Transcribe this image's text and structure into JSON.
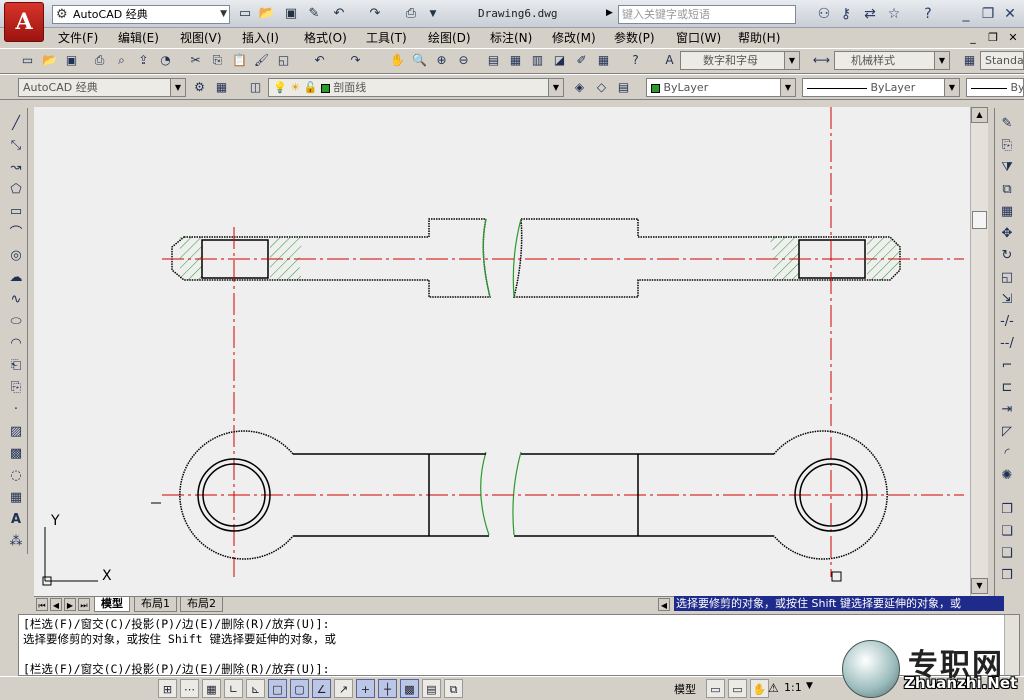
{
  "app": {
    "logo_letter": "A",
    "workspace": "AutoCAD 经典",
    "doc_title": "Drawing6.dwg",
    "search_placeholder": "键入关键字或短语"
  },
  "menubar": [
    "文件(F)",
    "编辑(E)",
    "视图(V)",
    "插入(I)",
    "格式(O)",
    "工具(T)",
    "绘图(D)",
    "标注(N)",
    "修改(M)",
    "参数(P)",
    "窗口(W)",
    "帮助(H)"
  ],
  "toolbar1": {
    "text_style": "数字和字母",
    "dim_style": "机械样式",
    "table_style": "Standa"
  },
  "toolbar2": {
    "workspace": "AutoCAD 经典",
    "layer": "剖面线",
    "color": "ByLayer",
    "linetype": "ByLayer",
    "lineweight": "By"
  },
  "tabs": [
    "模型",
    "布局1",
    "布局2"
  ],
  "status_prompt": "选择要修剪的对象，或按住 Shift 键选择要延伸的对象，或",
  "command": {
    "lines": [
      "[栏选(F)/窗交(C)/投影(P)/边(E)/删除(R)/放弃(U)]:",
      "选择要修剪的对象，或按住 Shift 键选择要延伸的对象，或",
      "",
      "[栏选(F)/窗交(C)/投影(P)/边(E)/删除(R)/放弃(U)]:"
    ]
  },
  "statusbar": {
    "model": "模型",
    "scale": "1:1"
  },
  "ucs": {
    "x": "X",
    "y": "Y"
  },
  "watermark": {
    "text": "专职网",
    "url": "Zhuanzhi.Net"
  },
  "colors": {
    "centerline": "#d00000",
    "hatch": "#2a9a2a",
    "canvas": "#efefef",
    "prompt_bg": "#1f2b8b"
  }
}
